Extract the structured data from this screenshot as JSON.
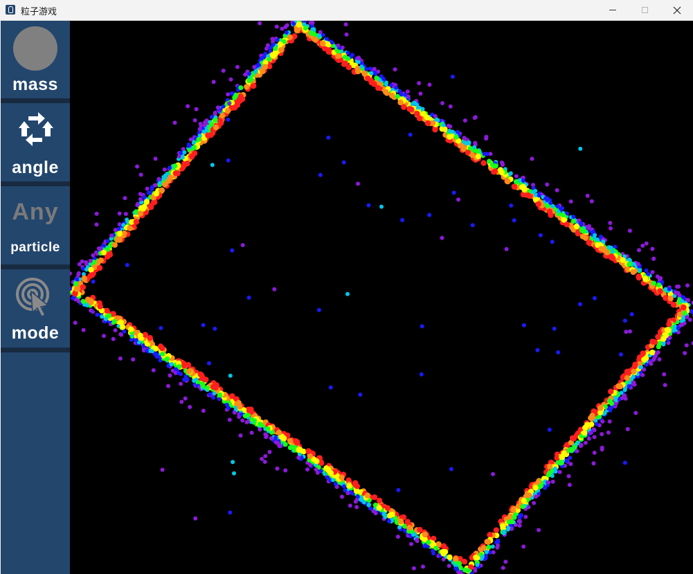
{
  "window": {
    "title": "粒子游戏",
    "controls": [
      "minimize",
      "maximize",
      "close"
    ]
  },
  "sidebar": {
    "tools": [
      {
        "id": "mass",
        "label": "mass",
        "icon": "gray-circle-icon"
      },
      {
        "id": "angle",
        "label": "angle",
        "icon": "rotate-arrows-icon"
      },
      {
        "id": "particle",
        "label": "particle",
        "option": "Any"
      },
      {
        "id": "mode",
        "label": "mode",
        "icon": "target-cursor-icon"
      }
    ]
  },
  "simulation": {
    "shape": "rotated-rectangle",
    "particle_colors": [
      "#ff1f1f",
      "#ff8c1a",
      "#ffff00",
      "#1aff1a",
      "#00c8e6",
      "#1a1aff",
      "#8c1ad9"
    ]
  }
}
